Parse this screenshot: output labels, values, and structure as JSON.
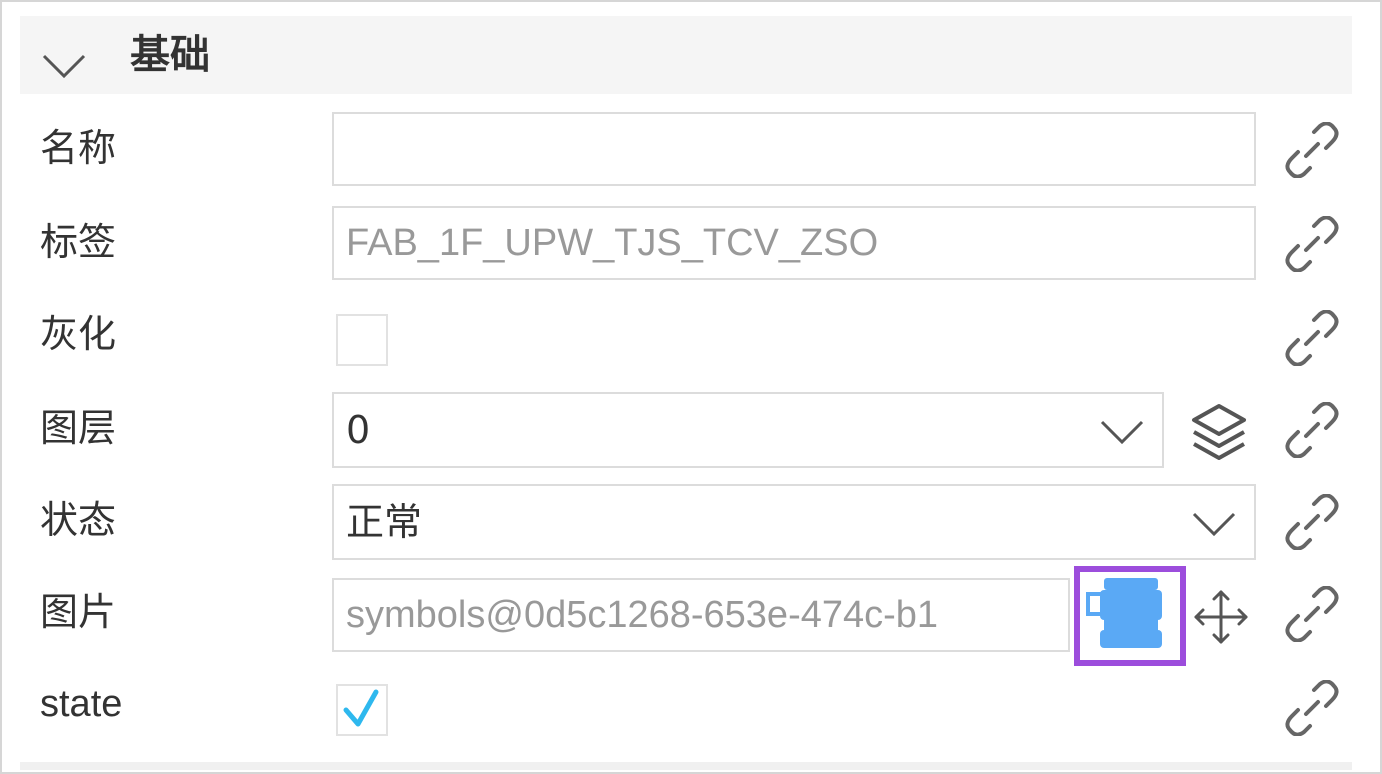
{
  "section": {
    "title": "基础",
    "collapsed": false
  },
  "fields": {
    "name": {
      "label": "名称",
      "value": ""
    },
    "tag": {
      "label": "标签",
      "value": "FAB_1F_UPW_TJS_TCV_ZSO"
    },
    "gray": {
      "label": "灰化",
      "checked": false
    },
    "layer": {
      "label": "图层",
      "value": "0"
    },
    "status": {
      "label": "状态",
      "value": "正常"
    },
    "image": {
      "label": "图片",
      "value": "symbols@0d5c1268-653e-474c-b1"
    },
    "state": {
      "label": "state",
      "checked": true
    }
  },
  "icons": {
    "collapse": "chevron-down-icon",
    "link": "link-icon",
    "layers": "layers-icon",
    "move": "move-icon",
    "image_preview": "symbol-preview-icon"
  },
  "colors": {
    "highlight_border": "#9c4ddc",
    "check_color": "#2eb8ee",
    "symbol_color": "#5aa9f5"
  }
}
